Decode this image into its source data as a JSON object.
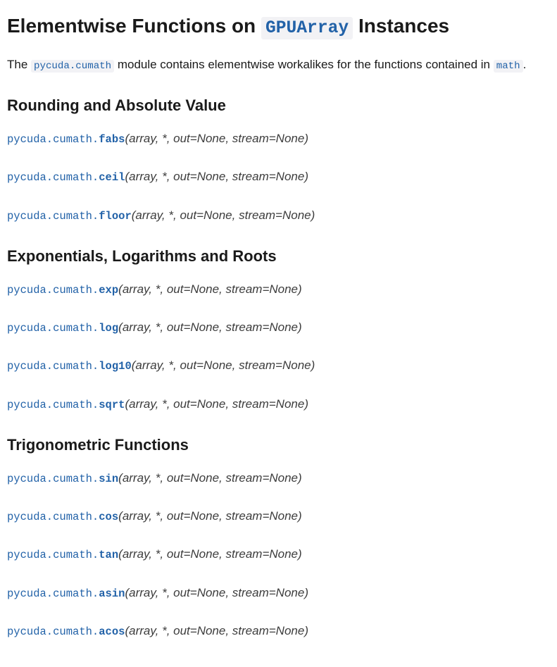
{
  "heading": {
    "pre": "Elementwise Functions on ",
    "code": "GPUArray",
    "post": " Instances"
  },
  "intro": {
    "pre": "The ",
    "module": "pycuda.cumath",
    "mid": " module contains elementwise workalikes for the functions contained in ",
    "mathLink": "math",
    "post": "."
  },
  "module_prefix": "pycuda.cumath.",
  "signature": "(array, *, out=None, stream=None)",
  "sections": [
    {
      "title": "Rounding and Absolute Value",
      "funcs": [
        "fabs",
        "ceil",
        "floor"
      ]
    },
    {
      "title": "Exponentials, Logarithms and Roots",
      "funcs": [
        "exp",
        "log",
        "log10",
        "sqrt"
      ]
    },
    {
      "title": "Trigonometric Functions",
      "funcs": [
        "sin",
        "cos",
        "tan",
        "asin",
        "acos"
      ]
    }
  ]
}
